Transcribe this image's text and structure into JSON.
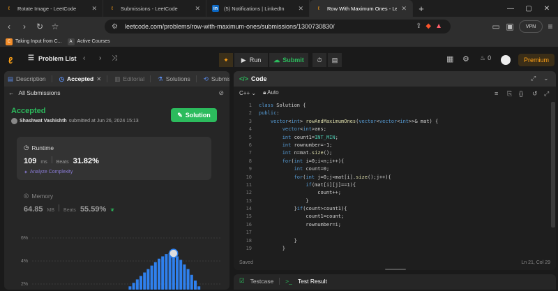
{
  "browser": {
    "tabs": [
      {
        "label": "Rotate Image - LeetCode",
        "icon": "leetcode-icon",
        "active": false
      },
      {
        "label": "Submissions - LeetCode",
        "icon": "leetcode-icon",
        "active": false
      },
      {
        "label": "(5) Notifications | LinkedIn",
        "icon": "linkedin-icon",
        "active": false
      },
      {
        "label": "Row With Maximum Ones - Lee",
        "icon": "leetcode-icon",
        "active": true
      }
    ],
    "url": "leetcode.com/problems/row-with-maximum-ones/submissions/1300730830/",
    "vpn_label": "VPN",
    "bookmarks": [
      {
        "label": "Taking Input from C...",
        "icon": "bookmark-app-icon"
      },
      {
        "label": "Active Courses",
        "icon": "course-icon"
      }
    ]
  },
  "lc_header": {
    "problem_list": "Problem List",
    "run": "Run",
    "submit": "Submit",
    "streak": "0",
    "premium": "Premium"
  },
  "left_panel": {
    "tabs": {
      "description": "Description",
      "accepted": "Accepted",
      "editorial": "Editorial",
      "solutions": "Solutions",
      "submissions": "Submission"
    },
    "all_submissions": "All Submissions",
    "status": "Accepted",
    "author": "Shashwat Vashishth",
    "submitted_at": "submitted at Jun 26, 2024 15:13",
    "solution_button": "Solution",
    "runtime": {
      "title": "Runtime",
      "value": "109",
      "unit": "ms",
      "beats_label": "Beats",
      "beats": "31.82%",
      "analyze": "Analyze Complexity"
    },
    "memory": {
      "title": "Memory",
      "value": "64.85",
      "unit": "MB",
      "beats_label": "Beats",
      "beats": "55.59%"
    },
    "chart_labels": {
      "y1": "6%",
      "y2": "4%",
      "y3": "2%"
    }
  },
  "chart_data": {
    "type": "bar",
    "ylabel": "",
    "xlabel": "",
    "ylim": [
      0,
      6
    ],
    "yticks": [
      "2%",
      "4%",
      "6%"
    ],
    "values": [
      0.1,
      0.2,
      0.3,
      0.6,
      0.9,
      1.2,
      1.5,
      1.8,
      2.1,
      2.4,
      2.7,
      3.0,
      3.3,
      3.6,
      3.9,
      4.2,
      4.4,
      4.6,
      4.7,
      4.6,
      4.4,
      4.1,
      3.7,
      3.3,
      2.8,
      2.3,
      1.8,
      1.3,
      0.8,
      0.4
    ],
    "highlight_index": 19,
    "color": "#2f80ed"
  },
  "code_panel": {
    "title": "Code",
    "language": "C++",
    "mode": "Auto",
    "line_numbers": [
      "1",
      "2",
      "3",
      "4",
      "5",
      "6",
      "7",
      "8",
      "9",
      "10",
      "11",
      "12",
      "13",
      "14",
      "15",
      "16",
      "17",
      "18",
      "19"
    ],
    "lines": [
      "class Solution {",
      "public:",
      "    vector<int> rowAndMaximumOnes(vector<vector<int>>& mat) {",
      "        vector<int>ans;",
      "        int count1=INT_MIN;",
      "        int rownumber=-1;",
      "        int n=mat.size();",
      "        for(int i=0;i<n;i++){",
      "            int count=0;",
      "            for(int j=0;j<mat[i].size();j++){",
      "                if(mat[i][j]==1){",
      "                    count++;",
      "                }",
      "            }if(count>count1){",
      "                count1=count;",
      "                rownumber=i;",
      "",
      "            }",
      "        }"
    ],
    "status": "Saved",
    "cursor": "Ln 21, Col 29"
  },
  "bottom_panel": {
    "testcase": "Testcase",
    "test_result": "Test Result"
  }
}
